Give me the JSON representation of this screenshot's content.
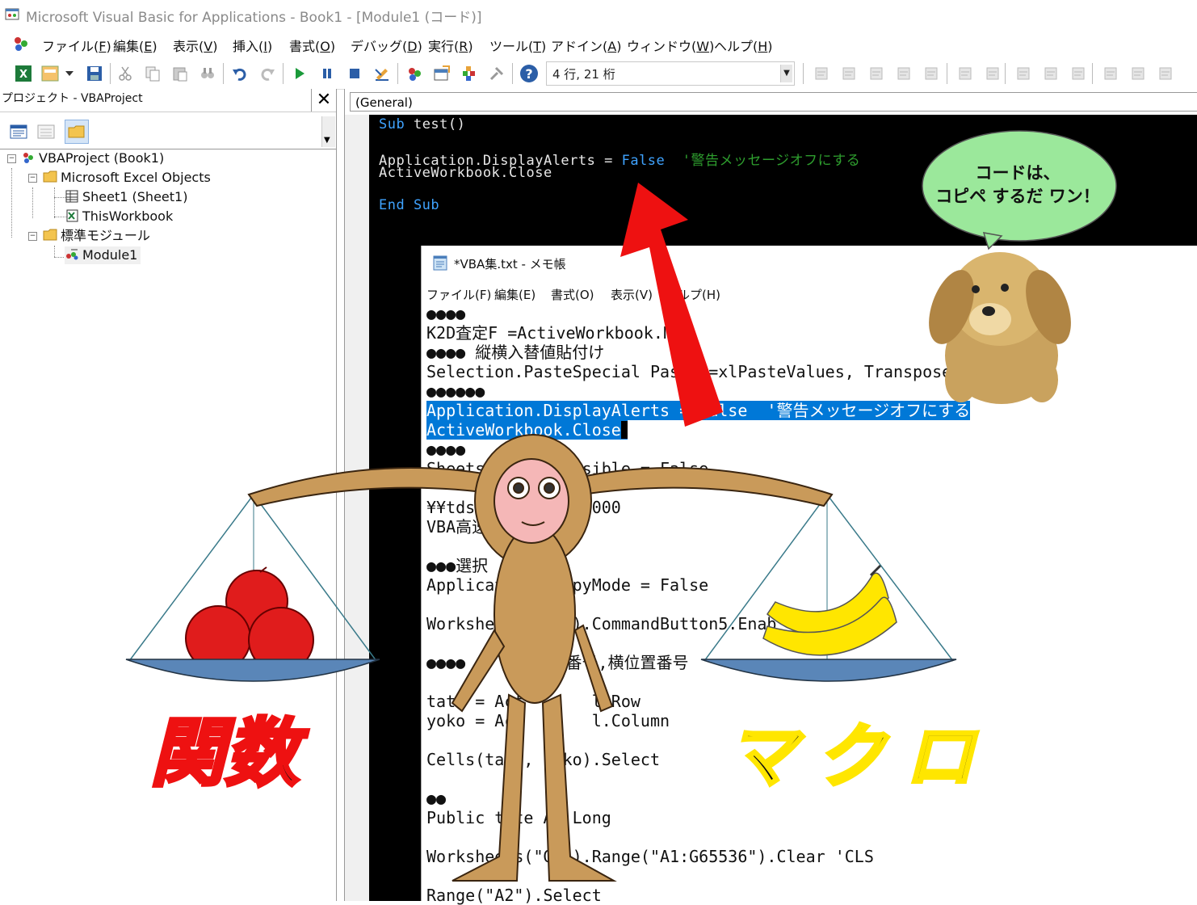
{
  "window": {
    "title": "Microsoft Visual Basic for Applications - Book1 - [Module1 (コード)]"
  },
  "menu": [
    {
      "label": "ファイル(",
      "key": "F",
      "end": ")"
    },
    {
      "label": "編集(",
      "key": "E",
      "end": ")"
    },
    {
      "label": "表示(",
      "key": "V",
      "end": ")"
    },
    {
      "label": "挿入(",
      "key": "I",
      "end": ")"
    },
    {
      "label": "書式(",
      "key": "O",
      "end": ")"
    },
    {
      "label": "デバッグ(",
      "key": "D",
      "end": ")"
    },
    {
      "label": "実行(",
      "key": "R",
      "end": ")"
    },
    {
      "label": "ツール(",
      "key": "T",
      "end": ")"
    },
    {
      "label": "アドイン(",
      "key": "A",
      "end": ")"
    },
    {
      "label": "ウィンドウ(",
      "key": "W",
      "end": ")"
    },
    {
      "label": "ヘルプ(",
      "key": "H",
      "end": ")"
    }
  ],
  "toolbar": {
    "cursor_position": "4 行, 21 桁"
  },
  "project": {
    "title": "プロジェクト - VBAProject",
    "tree": {
      "root": "VBAProject (Book1)",
      "excel_objects": "Microsoft Excel Objects",
      "sheet1": "Sheet1 (Sheet1)",
      "thisworkbook": "ThisWorkbook",
      "modules": "標準モジュール",
      "module1": "Module1"
    }
  },
  "code": {
    "object_combo": "(General)",
    "line1_kw": "Sub",
    "line1_rest": " test()",
    "line2_a": "Application.DisplayAlerts = ",
    "line2_kw": "False",
    "line2_cm": "  '警告メッセージオフにする",
    "line3": "ActiveWorkbook.Close",
    "line4_kw": "End Sub"
  },
  "notepad": {
    "title": "*VBA集.txt - メモ帳",
    "menu": [
      "ファイル(F)",
      "編集(E)",
      "書式(O)",
      "表示(V)",
      "ヘルプ(H)"
    ],
    "lines": [
      "●●●●",
      "K2D査定F =ActiveWorkbook.Na",
      "●●●● 縦横入替値貼付け",
      "Selection.PasteSpecial Paste:=xlPasteValues, Transpose:=T",
      "●●●●●●",
      "Application.DisplayAlerts = False  '警告メッセージオフにする",
      "ActiveWorkbook.Close",
      "●●●●",
      "Sheets(\"   \").Visible = False",
      "",
      "¥¥tds\\     \\ce¥50000",
      "VBA高速他  ピー",
      "",
      "●●●選択",
      "Applicati    CopyMode = False",
      "",
      "Worksheet     \").CommandButton5.Enab",
      "",
      "●●●●       縦位番号,横位置番号",
      "",
      "tate = Act       l.Row",
      "yoko = Act       l.Column",
      "",
      "Cells(tate,   ko).Select",
      "",
      "●●",
      "Public tate As Long",
      "",
      "Worksheets(\"GK\").Range(\"A1:G65536\").Clear 'CLS",
      "",
      "Range(\"A2\").Select"
    ]
  },
  "overlay": {
    "bubble_line1": "コードは、",
    "bubble_line2": "コピペ するだ ワン！",
    "left_label": "関数",
    "right_label": "マクロ"
  }
}
